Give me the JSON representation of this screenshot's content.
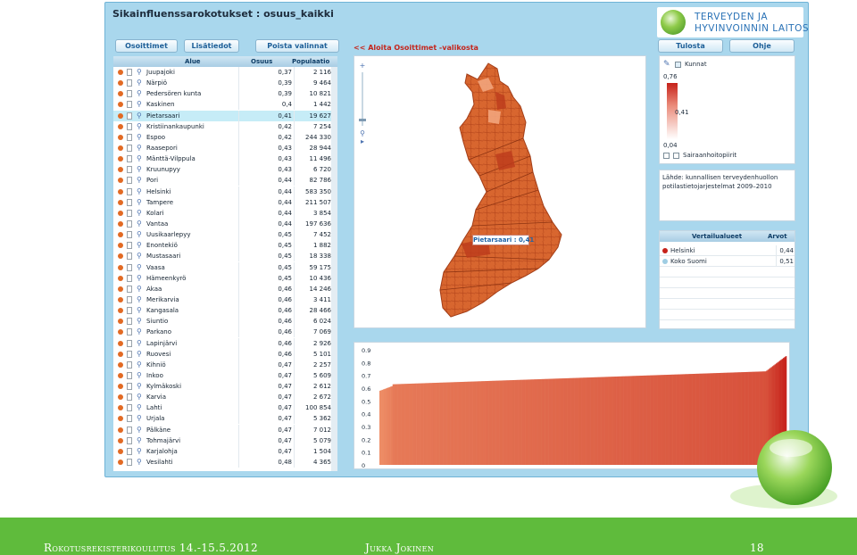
{
  "title": "Sikainfluenssarokotukset : osuus_kaikki",
  "logo": {
    "line1": "TERVEYDEN JA",
    "line2": "HYVINVOINNIN LAITOS"
  },
  "buttons": {
    "targets": "Osoittimet",
    "extra": "Lisätiedot",
    "clear": "Poista valinnat",
    "print": "Tulosta",
    "help": "Ohje"
  },
  "hint": "<< Aloita Osoittimet -valikosta",
  "table": {
    "headers": {
      "area": "Alue",
      "share": "Osuus",
      "population": "Populaatio"
    },
    "rows": [
      [
        "Juupajoki",
        "0,37",
        "2 116"
      ],
      [
        "Närpiö",
        "0,39",
        "9 464"
      ],
      [
        "Pedersören kunta",
        "0,39",
        "10 821"
      ],
      [
        "Kaskinen",
        "0,4",
        "1 442"
      ],
      [
        "Pietarsaari",
        "0,41",
        "19 627"
      ],
      [
        "Kristiinankaupunki",
        "0,42",
        "7 254"
      ],
      [
        "Espoo",
        "0,42",
        "244 330"
      ],
      [
        "Raasepori",
        "0,43",
        "28 944"
      ],
      [
        "Mänttä-Vilppula",
        "0,43",
        "11 496"
      ],
      [
        "Kruunupyy",
        "0,43",
        "6 720"
      ],
      [
        "Pori",
        "0,44",
        "82 786"
      ],
      [
        "Helsinki",
        "0,44",
        "583 350"
      ],
      [
        "Tampere",
        "0,44",
        "211 507"
      ],
      [
        "Kolari",
        "0,44",
        "3 854"
      ],
      [
        "Vantaa",
        "0,44",
        "197 636"
      ],
      [
        "Uusikaarlepyy",
        "0,45",
        "7 452"
      ],
      [
        "Enontekiö",
        "0,45",
        "1 882"
      ],
      [
        "Mustasaari",
        "0,45",
        "18 338"
      ],
      [
        "Vaasa",
        "0,45",
        "59 175"
      ],
      [
        "Hämeenkyrö",
        "0,45",
        "10 436"
      ],
      [
        "Akaa",
        "0,46",
        "14 246"
      ],
      [
        "Merikarvia",
        "0,46",
        "3 411"
      ],
      [
        "Kangasala",
        "0,46",
        "28 466"
      ],
      [
        "Siuntio",
        "0,46",
        "6 024"
      ],
      [
        "Parkano",
        "0,46",
        "7 069"
      ],
      [
        "Lapinjärvi",
        "0,46",
        "2 926"
      ],
      [
        "Ruovesi",
        "0,46",
        "5 101"
      ],
      [
        "Kihniö",
        "0,47",
        "2 257"
      ],
      [
        "Inkoo",
        "0,47",
        "5 609"
      ],
      [
        "Kylmäkoski",
        "0,47",
        "2 612"
      ],
      [
        "Karvia",
        "0,47",
        "2 672"
      ],
      [
        "Lahti",
        "0,47",
        "100 854"
      ],
      [
        "Urjala",
        "0,47",
        "5 362"
      ],
      [
        "Pälkäne",
        "0,47",
        "7 012"
      ],
      [
        "Tohmajärvi",
        "0,47",
        "5 079"
      ],
      [
        "Karjalohja",
        "0,47",
        "1 504"
      ],
      [
        "Vesilahti",
        "0,48",
        "4 365"
      ]
    ],
    "highlighted_row": "Pietarsaari"
  },
  "map": {
    "callout": "Pietarsaari : 0,41"
  },
  "legend": {
    "layer_label": "Kunnat",
    "max": "0,76",
    "mid": "0,41",
    "min": "0,04",
    "layer2_label": "Sairaanhoitopiirit"
  },
  "source": {
    "line1": "Lähde: kunnallisen terveydenhuollon",
    "line2": "potilastietojarjestelmat 2009–2010"
  },
  "comparison": {
    "headers": {
      "name": "Vertailualueet",
      "value": "Arvot"
    },
    "rows": [
      {
        "name": "Helsinki",
        "value": "0,44",
        "color": "#c6211a"
      },
      {
        "name": "Koko Suomi",
        "value": "0,51",
        "color": "#9fcde3"
      }
    ]
  },
  "chart_data": {
    "type": "bar",
    "yticks": [
      "0.9",
      "0.8",
      "0.7",
      "0.6",
      "0.5",
      "0.4",
      "0.3",
      "0.2",
      "0.1",
      "0"
    ],
    "ylim": [
      0,
      0.9
    ],
    "n_bars": 340,
    "values_range": [
      0.04,
      0.76
    ],
    "colors": {
      "low": "#f29a6e",
      "high": "#c6211a"
    }
  },
  "footer": {
    "left": "Rokotusrekisterikoulutus 14.-15.5.2012",
    "center": "Jukka Jokinen",
    "right": "18"
  }
}
